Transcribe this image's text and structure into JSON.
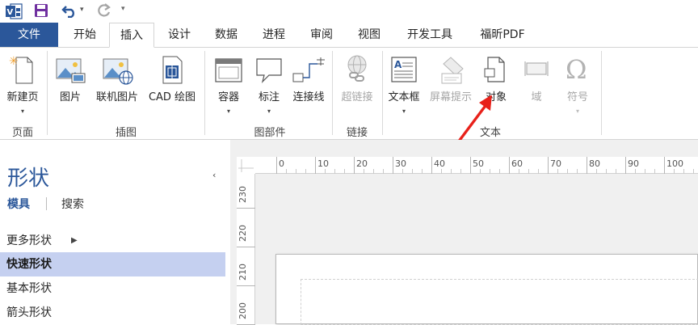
{
  "qat": {
    "app_logo_icon": "visio-logo-icon",
    "save_icon": "save-icon",
    "undo_icon": "undo-icon",
    "redo_icon": "redo-icon",
    "undo_dropdown": "▾",
    "customize": "▾"
  },
  "tabs": [
    {
      "label": "文件"
    },
    {
      "label": "开始"
    },
    {
      "label": "插入"
    },
    {
      "label": "设计"
    },
    {
      "label": "数据"
    },
    {
      "label": "进程"
    },
    {
      "label": "审阅"
    },
    {
      "label": "视图"
    },
    {
      "label": "开发工具"
    },
    {
      "label": "福昕PDF"
    }
  ],
  "ribbon": {
    "page_group": {
      "new_page": "新建页",
      "label": "页面"
    },
    "illustrations_group": {
      "picture": "图片",
      "online_picture": "联机图片",
      "cad": "CAD 绘图",
      "label": "插图"
    },
    "diagram_parts_group": {
      "container": "容器",
      "callout": "标注",
      "connector": "连接线",
      "label": "图部件"
    },
    "links_group": {
      "hyperlink": "超链接",
      "label": "链接"
    },
    "text_group": {
      "textbox": "文本框",
      "screentip": "屏幕提示",
      "object": "对象",
      "field": "域",
      "symbol": "符号",
      "label": "文本"
    },
    "caret": "▾"
  },
  "colors": {
    "accent": "#2b579a",
    "selected_row": "#c5d0f0",
    "annotation_arrow": "#e8211a"
  },
  "pane": {
    "title": "形状",
    "collapse": "‹",
    "tab_stencils": "模具",
    "tab_search": "搜索",
    "stencils": [
      {
        "label": "更多形状",
        "arrow": "▶"
      },
      {
        "label": "快速形状"
      },
      {
        "label": "基本形状"
      },
      {
        "label": "箭头形状"
      }
    ]
  },
  "ruler": {
    "h_labels": [
      "0",
      "10",
      "20",
      "30",
      "40",
      "50",
      "60",
      "70",
      "80",
      "90",
      "100"
    ],
    "v_labels": [
      "230",
      "220",
      "210",
      "200"
    ]
  }
}
